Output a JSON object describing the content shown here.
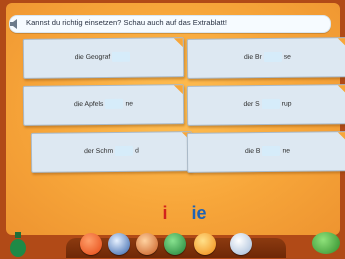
{
  "task": {
    "text": "Kannst du richtig einsetzen? Schau auch auf das Extrablatt!"
  },
  "cards": [
    {
      "before": "die Geograf",
      "after": ""
    },
    {
      "before": "die Br",
      "after": "se"
    },
    {
      "before": "die Apfels",
      "after": "ne"
    },
    {
      "before": "der S",
      "after": "rup"
    },
    {
      "before": "der Schm",
      "after": "d"
    },
    {
      "before": "die B",
      "after": "ne"
    }
  ],
  "choices": {
    "i": "i",
    "ie": "ie"
  },
  "colors": {
    "choice_i": "#d2231c",
    "choice_ie": "#1f63b4"
  },
  "toolbar": {
    "icons": [
      "bottle-icon",
      "home-icon",
      "keyboard-icon",
      "speaker-icon",
      "globe-icon",
      "music-icon",
      "page-icon",
      "check-icon"
    ]
  }
}
